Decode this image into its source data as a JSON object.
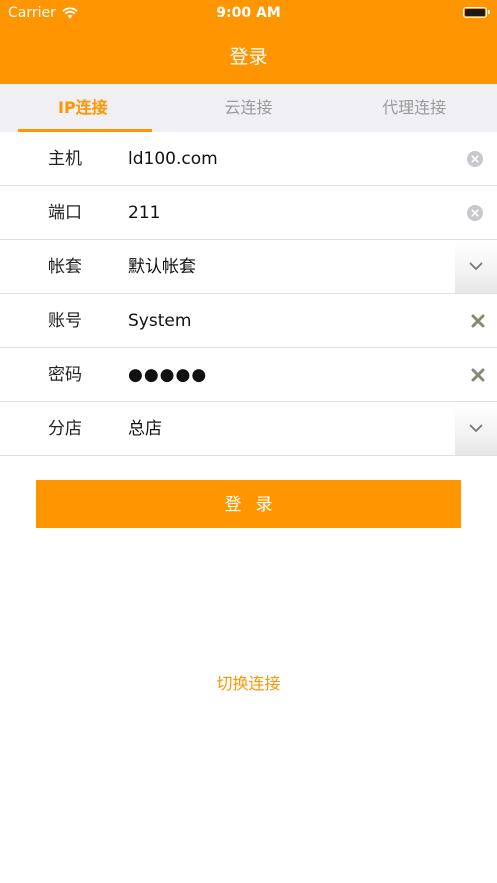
{
  "status_bar": {
    "carrier": "Carrier",
    "time": "9:00 AM"
  },
  "nav": {
    "title": "登录"
  },
  "tabs": [
    {
      "label": "IP连接",
      "active": true
    },
    {
      "label": "云连接",
      "active": false
    },
    {
      "label": "代理连接",
      "active": false
    }
  ],
  "form": {
    "rows": [
      {
        "label": "主机",
        "value": "ld100.com",
        "accessory": "clear-circle-icon"
      },
      {
        "label": "端口",
        "value": "211",
        "accessory": "clear-circle-icon"
      },
      {
        "label": "帐套",
        "value": "默认帐套",
        "accessory": "chevron-down-icon"
      },
      {
        "label": "账号",
        "value": "System",
        "accessory": "x-icon"
      },
      {
        "label": "密码",
        "value": "●●●●●",
        "accessory": "x-icon"
      },
      {
        "label": "分店",
        "value": "总店",
        "accessory": "chevron-down-icon"
      }
    ]
  },
  "login_button": {
    "label": "登录"
  },
  "switch_link": {
    "label": "切换连接"
  },
  "colors": {
    "accent": "#ff9500",
    "tab_bg": "#efeff4",
    "inactive_tab": "#9b9b9b"
  }
}
